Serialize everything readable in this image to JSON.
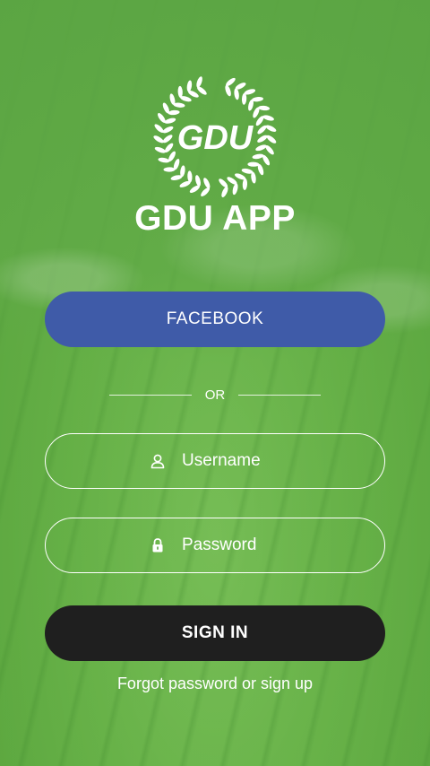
{
  "brand": {
    "logo_text": "GDU",
    "app_title": "GDU APP"
  },
  "auth": {
    "facebook_label": "FACEBOOK",
    "divider_label": "OR",
    "username": {
      "placeholder": "Username",
      "value": "",
      "icon": "user-icon"
    },
    "password": {
      "placeholder": "Password",
      "value": "",
      "icon": "lock-icon"
    },
    "signin_label": "SIGN IN",
    "footer_link": "Forgot password or sign up"
  },
  "colors": {
    "facebook_blue": "#3f5ba8",
    "signin_dark": "#1f1f1f",
    "overlay_green": "#5ca644",
    "text": "#ffffff"
  }
}
